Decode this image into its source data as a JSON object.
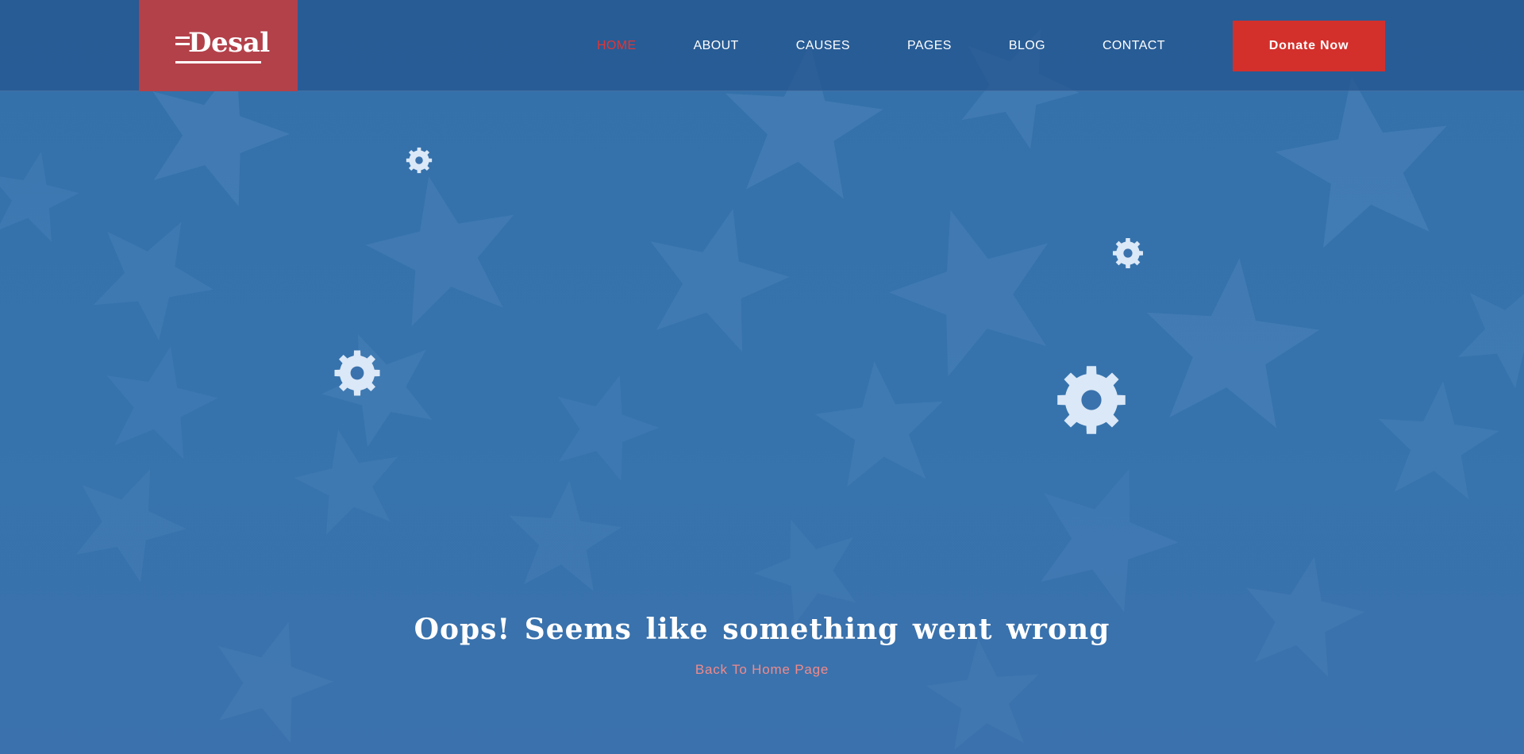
{
  "brand": {
    "logo_text": "Desal",
    "color": "#b3414a"
  },
  "nav": {
    "items": [
      {
        "label": "HOME",
        "active": true
      },
      {
        "label": "ABOUT",
        "active": false
      },
      {
        "label": "CAUSES",
        "active": false
      },
      {
        "label": "PAGES",
        "active": false
      },
      {
        "label": "BLOG",
        "active": false
      },
      {
        "label": "CONTACT",
        "active": false
      }
    ],
    "active_color": "#e03535"
  },
  "donate_button": {
    "label": "Donate Now",
    "color": "#d3302c"
  },
  "error": {
    "title": "Oops!  Seems like something went wrong",
    "link_label": "Back To Home Page",
    "link_color": "#f08a8a"
  },
  "decor": {
    "icon": "gear-icon",
    "gear_color": "#dbe8f7",
    "background_motif": "star-pattern"
  }
}
